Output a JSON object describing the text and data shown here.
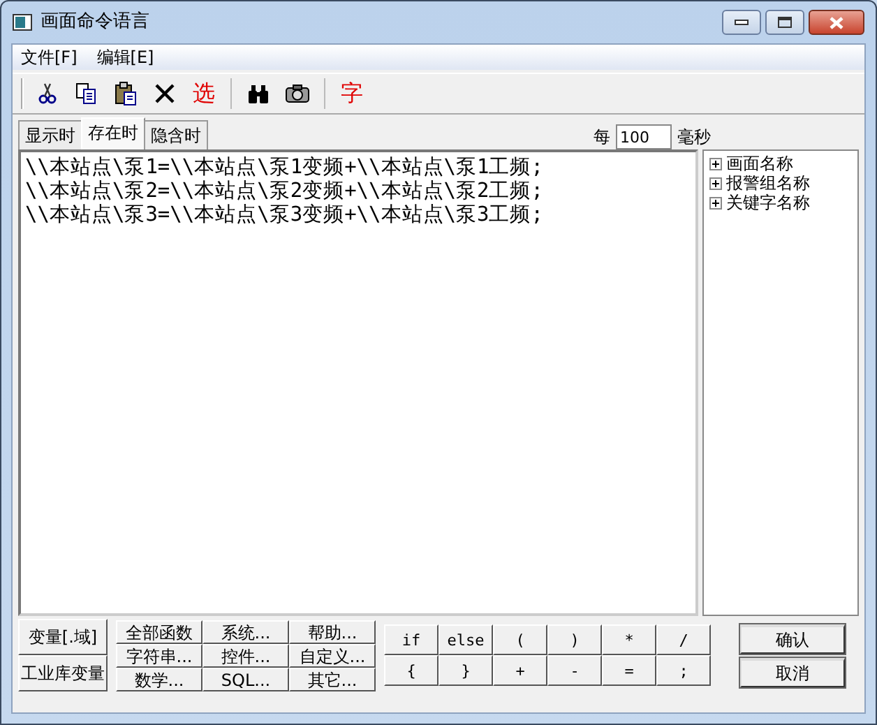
{
  "window": {
    "title": "画面命令语言"
  },
  "menu": [
    {
      "label": "文件[F]"
    },
    {
      "label": "编辑[E]"
    }
  ],
  "toolbar": [
    {
      "kind": "cut"
    },
    {
      "kind": "copy"
    },
    {
      "kind": "paste"
    },
    {
      "kind": "delete"
    },
    {
      "kind": "text",
      "text": "选"
    },
    {
      "kind": "separator"
    },
    {
      "kind": "find"
    },
    {
      "kind": "camera"
    },
    {
      "kind": "separator"
    },
    {
      "kind": "text",
      "text": "字"
    }
  ],
  "tabs": [
    {
      "label": "显示时",
      "selected": false
    },
    {
      "label": "存在时",
      "selected": true
    },
    {
      "label": "隐含时",
      "selected": false
    }
  ],
  "interval": {
    "label": "每",
    "value": "100",
    "unit": "毫秒"
  },
  "editor": {
    "lines": [
      "\\\\本站点\\泵1=\\\\本站点\\泵1变频+\\\\本站点\\泵1工频;",
      "\\\\本站点\\泵2=\\\\本站点\\泵2变频+\\\\本站点\\泵2工频;",
      "\\\\本站点\\泵3=\\\\本站点\\泵3变频+\\\\本站点\\泵3工频;"
    ]
  },
  "tree": [
    {
      "label": "画面名称",
      "expanded": false
    },
    {
      "label": "报警组名称",
      "expanded": false
    },
    {
      "label": "关键字名称",
      "expanded": false
    }
  ],
  "variable_buttons": [
    "变量[.域]",
    "工业库变量"
  ],
  "function_buttons": [
    "全部函数",
    "系统...",
    "帮助...",
    "字符串...",
    "控件...",
    "自定义...",
    "数学...",
    "SQL...",
    "其它..."
  ],
  "operator_buttons": [
    "if",
    "else",
    "(",
    ")",
    "*",
    "/",
    "{",
    "}",
    "+",
    "-",
    "=",
    ";"
  ],
  "dialog_buttons": [
    "确认",
    "取消"
  ]
}
